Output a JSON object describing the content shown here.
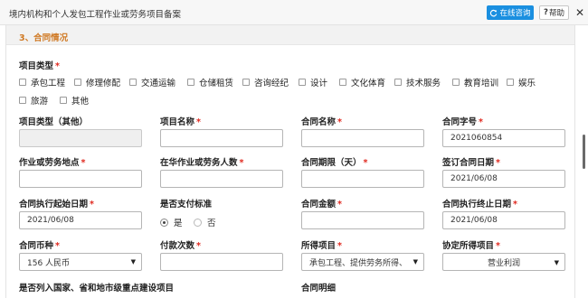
{
  "header": {
    "title": "境内机构和个人发包工程作业或劳务项目备案",
    "consult_label": "在线咨询",
    "help_label": "帮助",
    "help_icon": "question-icon",
    "close_icon": "close-icon"
  },
  "section": {
    "title": "3、合同情况",
    "accent": "#d07a25"
  },
  "project_type": {
    "label": "项目类型",
    "options": [
      "承包工程",
      "修理修配",
      "交通运输",
      "仓储租赁",
      "咨询经纪",
      "设计",
      "文化体育",
      "技术服务",
      "教育培训",
      "娱乐",
      "旅游",
      "其他"
    ]
  },
  "fields": {
    "project_type_other": {
      "label": "项目类型（其他）",
      "value": ""
    },
    "project_name": {
      "label": "项目名称",
      "value": ""
    },
    "contract_name": {
      "label": "合同名称",
      "value": ""
    },
    "contract_no": {
      "label": "合同字号",
      "value": "2021060854"
    },
    "work_location": {
      "label": "作业或劳务地点",
      "value": ""
    },
    "workers_in_china": {
      "label": "在华作业或劳务人数",
      "value": ""
    },
    "contract_term": {
      "label": "合同期限（天）",
      "value": ""
    },
    "sign_date": {
      "label": "签订合同日期",
      "value": "2021/06/08"
    },
    "start_date": {
      "label": "合同执行起始日期",
      "value": "2021/06/08"
    },
    "payment_standard": {
      "label": "是否支付标准",
      "yes": "是",
      "no": "否",
      "selected": "是"
    },
    "contract_amount": {
      "label": "合同金额",
      "value": ""
    },
    "end_date": {
      "label": "合同执行终止日期",
      "value": "2021/06/08"
    },
    "currency": {
      "label": "合同币种",
      "value": "156 人民币"
    },
    "payment_count": {
      "label": "付款次数",
      "value": ""
    },
    "income_item": {
      "label": "所得项目",
      "value": "承包工程、提供劳务所得、"
    },
    "agreed_income": {
      "label": "协定所得项目",
      "value": "营业利润"
    },
    "key_project": {
      "label": "是否列入国家、省和地市级重点建设项目"
    },
    "contract_detail": {
      "label": "合同明细"
    }
  },
  "colors": {
    "required_mark": "#e0281e",
    "consult_button": "#1a8fe0"
  }
}
